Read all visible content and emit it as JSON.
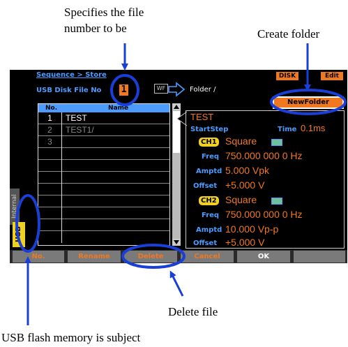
{
  "annotations": {
    "file_number_line1": "Specifies the file",
    "file_number_line2": "number to be",
    "create_folder": "Create folder",
    "delete_file": "Delete file",
    "usb_subject": "USB flash memory is subject"
  },
  "screen": {
    "breadcrumb": "Sequence > Store",
    "disk_badge": "DISK",
    "edit_badge": "Edit",
    "file_no_label": "USB Disk File No",
    "file_no_value": "1",
    "wf_icon": "WF",
    "folder_label": "Folder /",
    "new_folder_button": "NewFolder",
    "table": {
      "col_no": "No.",
      "col_name": "Name",
      "rows": [
        {
          "no": "1",
          "name": "TEST"
        },
        {
          "no": "2",
          "name": "TEST1/"
        },
        {
          "no": "3",
          "name": ""
        },
        {
          "no": "",
          "name": ""
        },
        {
          "no": "",
          "name": ""
        },
        {
          "no": "",
          "name": ""
        },
        {
          "no": "",
          "name": ""
        },
        {
          "no": "",
          "name": ""
        },
        {
          "no": "",
          "name": ""
        },
        {
          "no": "",
          "name": ""
        },
        {
          "no": "",
          "name": ""
        }
      ]
    },
    "detail": {
      "title": "TEST",
      "start_step_label": "StartStep",
      "time_label": "Time",
      "time_value": "0.1ms",
      "ch1": {
        "badge": "CH1",
        "wave": "Square",
        "freq_label": "Freq",
        "freq_value": "750.000 000 0 Hz",
        "amptd_label": "Amptd",
        "amptd_value": "5.000 Vpk",
        "offset_label": "Offset",
        "offset_value": "+5.000 V"
      },
      "ch2": {
        "badge": "CH2",
        "wave": "Square",
        "freq_label": "Freq",
        "freq_value": "750.000 000 0 Hz",
        "amptd_label": "Amptd",
        "amptd_value": "10.000 Vp-p",
        "offset_label": "Offset",
        "offset_value": "+5.000 V"
      }
    },
    "tabs": {
      "internal": "Internal",
      "usb": "USB"
    },
    "softkeys": [
      "No.",
      "Rename",
      "Delete",
      "Cancel",
      "OK",
      ""
    ]
  },
  "colors": {
    "accent_orange": "#f07820",
    "accent_blue": "#4c9cff",
    "highlight_yellow": "#f0d020",
    "annotation_blue": "#1a3fd6"
  }
}
